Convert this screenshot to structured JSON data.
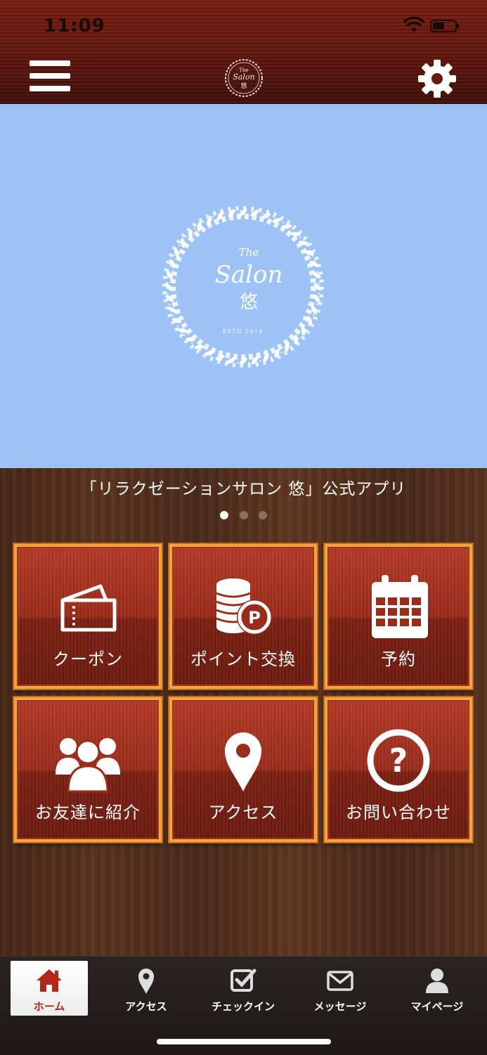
{
  "status_bar": {
    "time": "11:09"
  },
  "header": {
    "menu_icon": "hamburger-menu-icon",
    "settings_icon": "gear-icon",
    "logo_text_1": "The",
    "logo_text_2": "Salon",
    "logo_text_3": "悠"
  },
  "hero": {
    "logo_line1": "The",
    "logo_line2": "Salon",
    "logo_line3": "悠",
    "logo_estd": "ESTD 2018",
    "bg_color": "#9cc2f6"
  },
  "caption": "「リラクゼーションサロン 悠」公式アプリ",
  "carousel": {
    "count": 3,
    "active_index": 0
  },
  "tiles": [
    {
      "label": "クーポン",
      "icon": "ticket-icon"
    },
    {
      "label": "ポイント交換",
      "icon": "coins-icon"
    },
    {
      "label": "予約",
      "icon": "calendar-icon"
    },
    {
      "label": "お友達に紹介",
      "icon": "users-icon"
    },
    {
      "label": "アクセス",
      "icon": "map-pin-icon"
    },
    {
      "label": "お問い合わせ",
      "icon": "question-circle-icon"
    }
  ],
  "tabbar": [
    {
      "label": "ホーム",
      "icon": "home-icon",
      "active": true
    },
    {
      "label": "アクセス",
      "icon": "map-pin-icon",
      "active": false
    },
    {
      "label": "チェックイン",
      "icon": "checkbox-icon",
      "active": false
    },
    {
      "label": "メッセージ",
      "icon": "envelope-icon",
      "active": false
    },
    {
      "label": "マイページ",
      "icon": "user-icon",
      "active": false
    }
  ],
  "colors": {
    "header": "#6a1a10",
    "tile": "#9a2c1b",
    "tile_border": "#f2a444",
    "active_tab_text": "#b3281b"
  }
}
